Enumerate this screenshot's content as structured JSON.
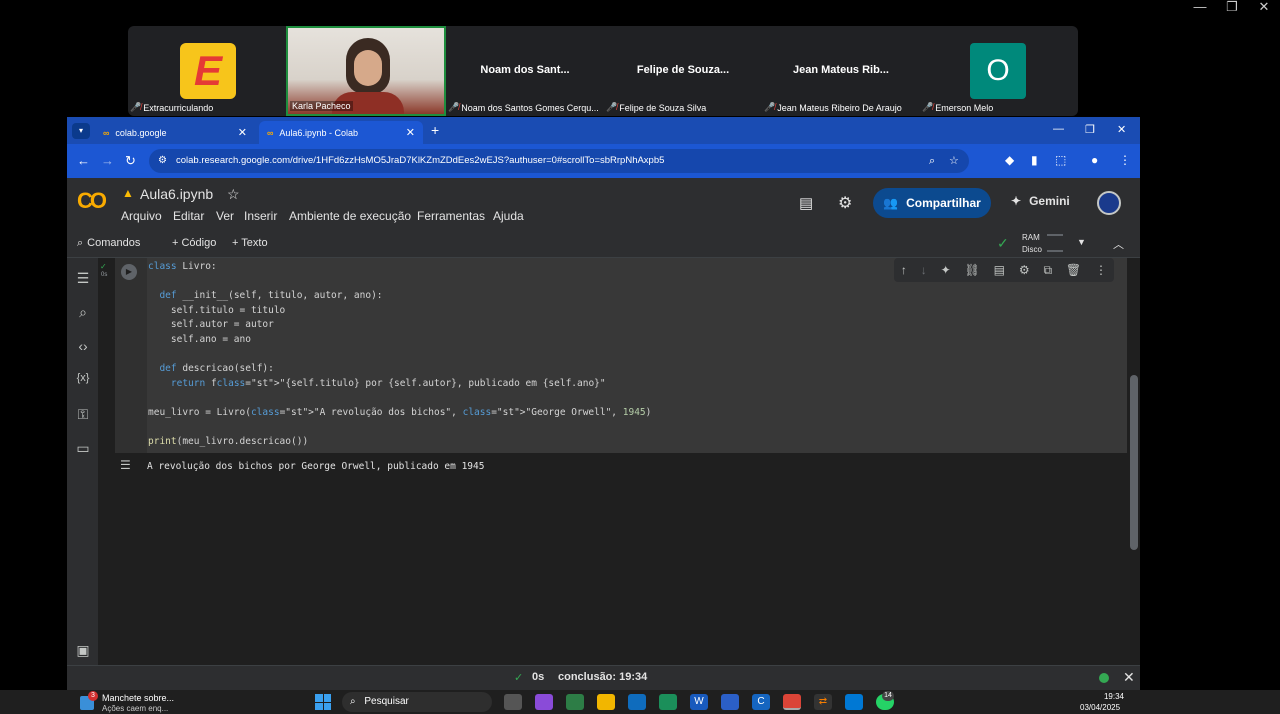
{
  "outer_window": {
    "minimize": "—",
    "restore": "❐",
    "close": "✕"
  },
  "meet": {
    "tiles": [
      {
        "caption": "Extracurriculando",
        "logo_letter": "E",
        "logo_color": "#f7c51b"
      },
      {
        "caption": "Karla Pacheco"
      },
      {
        "big_name": "Noam dos Sant...",
        "caption": "Noam dos Santos Gomes Cerqu..."
      },
      {
        "big_name": "Felipe de Souza...",
        "caption": "Felipe de Souza Silva"
      },
      {
        "big_name": "Jean Mateus Rib...",
        "caption": "Jean Mateus Ribeiro De Araujo"
      },
      {
        "caption": "Emerson Melo",
        "avatar_letter": "O",
        "avatar_color": "#00897b"
      }
    ]
  },
  "browser": {
    "tabs": [
      {
        "title": "colab.google",
        "close": "✕"
      },
      {
        "title": "Aula6.ipynb - Colab",
        "close": "✕"
      }
    ],
    "new_tab": "+",
    "window_ctrl": {
      "minimize": "—",
      "restore": "❐",
      "close": "✕"
    },
    "url": "colab.research.google.com/drive/1HFd6zzHsMO5JraD7KlKZmZDdEes2wEJS?authuser=0#scrollTo=sbRrpNhAxpb5"
  },
  "colab": {
    "logo": "CO",
    "notebook_title": "Aula6.ipynb",
    "menu": [
      "Arquivo",
      "Editar",
      "Ver",
      "Inserir",
      "Ambiente de execução",
      "Ferramentas",
      "Ajuda"
    ],
    "share_label": "Compartilhar",
    "gemini_label": "Gemini",
    "toolbar": {
      "commands": "Comandos",
      "code": "+ Código",
      "text": "+ Texto",
      "ram": "RAM",
      "disk": "Disco"
    },
    "cell": {
      "exec_count": "0s",
      "code_lines": [
        "class Livro:",
        "",
        "  def __init__(self, titulo, autor, ano):",
        "    self.titulo = titulo",
        "    self.autor = autor",
        "    self.ano = ano",
        "",
        "  def descricao(self):",
        "    return f\"{self.titulo} por {self.autor}, publicado em {self.ano}\"",
        "",
        "meu_livro = Livro(\"A revolução dos bichos\", \"George Orwell\", 1945)",
        "",
        "print(meu_livro.descricao())"
      ],
      "output": "A revolução dos bichos por George Orwell, publicado em 1945"
    },
    "status": {
      "check": "✓",
      "elapsed": "0s",
      "completion": "conclusão: 19:34"
    }
  },
  "taskbar": {
    "news_title": "Manchete sobre...",
    "news_sub": "Ações caem enq...",
    "news_badge": "3",
    "search_label": "Pesquisar",
    "whatsapp_badge": "14",
    "time": "19:34",
    "date": "03/04/2025"
  },
  "colors": {
    "accent_blue": "#1c57d3",
    "colab_orange": "#f9ab00",
    "share_bg": "#0c4a8f"
  }
}
